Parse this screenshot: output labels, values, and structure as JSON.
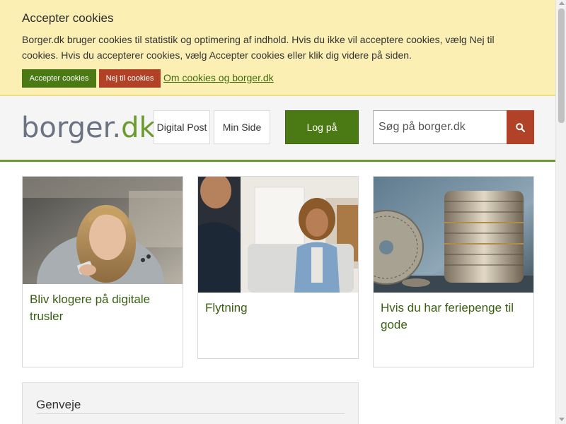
{
  "cookie_banner": {
    "title": "Accepter cookies",
    "text": "Borger.dk bruger cookies til statistik og optimering af indhold. Hvis du ikke vil acceptere cookies, vælg Nej til cookies. Hvis du accepterer cookies, vælg Accepter cookies eller klik dig videre på siden.",
    "accept_label": "Accepter cookies",
    "reject_label": "Nej til cookies",
    "info_link": "Om cookies og borger.dk"
  },
  "header": {
    "logo_part1": "borger.",
    "logo_part2": "dk",
    "nav": [
      {
        "label": "Digital Post"
      },
      {
        "label": "Min Side"
      }
    ],
    "login_label": "Log på",
    "search_placeholder": "Søg på borger.dk",
    "search_icon": "search-icon"
  },
  "cards": [
    {
      "title": "Bliv klogere på digitale trusler",
      "image": "woman-with-phone-photo"
    },
    {
      "title": "Flytning",
      "image": "moving-couple-photo"
    },
    {
      "title": "Hvis du har feriepenge til gode",
      "image": "coin-stacks-photo"
    }
  ],
  "shortcuts": {
    "title": "Genveje"
  },
  "colors": {
    "accent_green": "#4b7a14",
    "accent_red": "#b24227",
    "banner_bg": "#fbefb4",
    "link_green": "#3a5f10"
  }
}
